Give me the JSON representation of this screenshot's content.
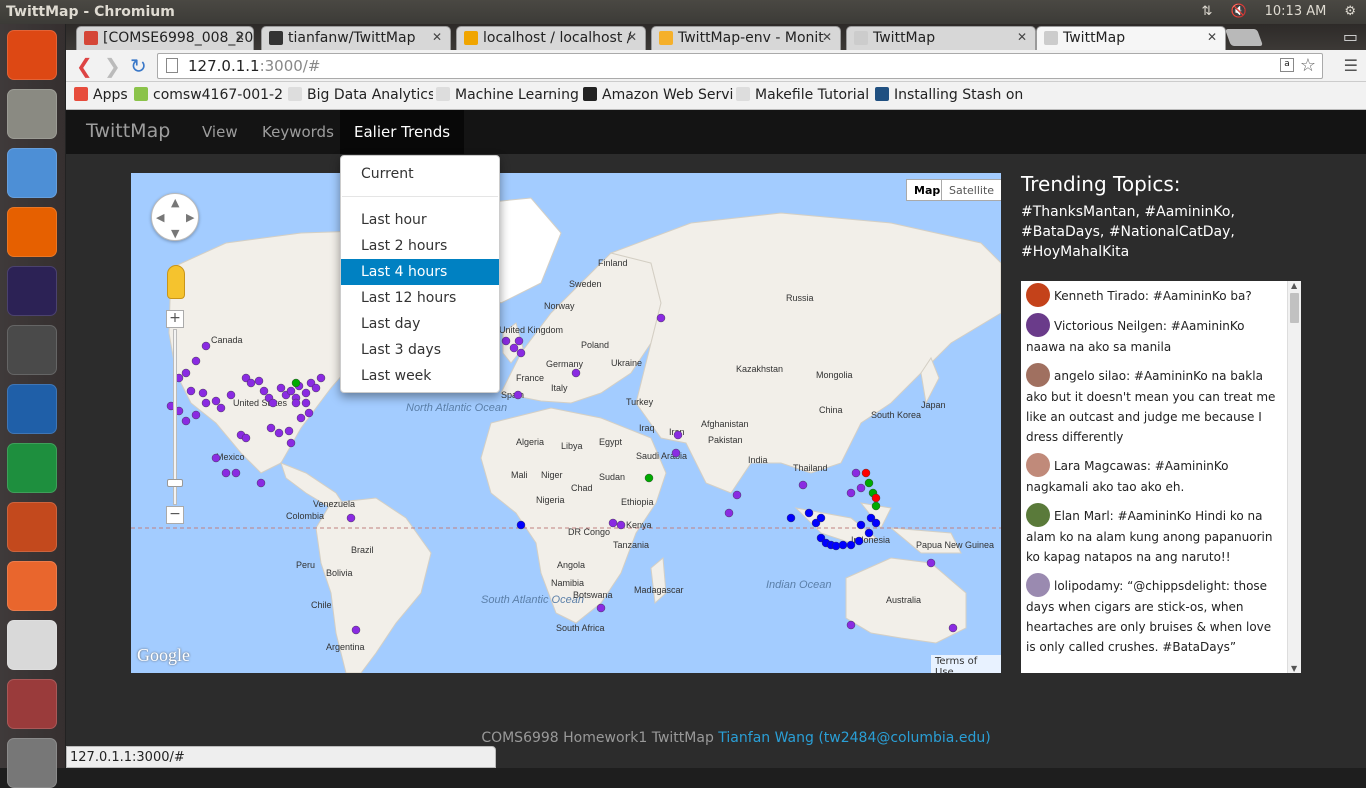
{
  "os": {
    "window_title": "TwittMap - Chromium",
    "clock": "10:13 AM",
    "launcher": [
      {
        "name": "ubuntu-dash-icon",
        "color": "#dd4814"
      },
      {
        "name": "files-icon",
        "color": "#8a8a82"
      },
      {
        "name": "chromium-icon",
        "color": "#4d8fd6"
      },
      {
        "name": "firefox-icon",
        "color": "#e66000"
      },
      {
        "name": "eclipse-icon",
        "color": "#2c2255"
      },
      {
        "name": "sublime-icon",
        "color": "#4a4a4a"
      },
      {
        "name": "writer-icon",
        "color": "#1f5fa8"
      },
      {
        "name": "calc-icon",
        "color": "#1e8f3e"
      },
      {
        "name": "impress-icon",
        "color": "#c3491d"
      },
      {
        "name": "software-center-icon",
        "color": "#e9662d"
      },
      {
        "name": "amazon-icon",
        "color": "#d9d9d9"
      },
      {
        "name": "system-settings-icon",
        "color": "#9a3b3b"
      },
      {
        "name": "trash-icon",
        "color": "#777777"
      }
    ]
  },
  "browser": {
    "tabs": [
      {
        "label": "[COMSE6998_008_20",
        "favicon_color": "#d54637"
      },
      {
        "label": "tianfanw/TwittMap",
        "favicon_color": "#333333"
      },
      {
        "label": "localhost / localhost /",
        "favicon_color": "#f0a500"
      },
      {
        "label": "TwittMap-env - Monit",
        "favicon_color": "#f5b02b"
      },
      {
        "label": "TwittMap",
        "favicon_color": "#cccccc"
      },
      {
        "label": "TwittMap",
        "favicon_color": "#cccccc"
      }
    ],
    "url_host": "127.0.1.1",
    "url_rest": ":3000/#",
    "bookmarks": [
      {
        "label": "Apps",
        "color": "#e74c3c"
      },
      {
        "label": "comsw4167-001-2",
        "color": "#8bc34a"
      },
      {
        "label": "Big Data Analytics",
        "color": "#dddddd"
      },
      {
        "label": "Machine Learning",
        "color": "#dddddd"
      },
      {
        "label": "Amazon Web Servi",
        "color": "#222222"
      },
      {
        "label": "Makefile Tutorial",
        "color": "#dddddd"
      },
      {
        "label": "Installing Stash on",
        "color": "#205081"
      }
    ],
    "status_url": "127.0.1.1:3000/#"
  },
  "app": {
    "brand": "TwittMap",
    "nav": {
      "view": "View",
      "keywords": "Keywords",
      "trends": "Ealier Trends"
    },
    "dropdown": {
      "current": "Current",
      "items": [
        "Last hour",
        "Last 2 hours",
        "Last 4 hours",
        "Last 12 hours",
        "Last day",
        "Last 3 days",
        "Last week"
      ],
      "selected": "Last 4 hours"
    },
    "map": {
      "map_button": "Map",
      "satellite_button": "Satellite",
      "google": "Google",
      "terms": "Terms of Use",
      "zoom_in": "+",
      "zoom_out": "−",
      "labels": [
        "Canada",
        "United States",
        "Mexico",
        "Venezuela",
        "Colombia",
        "Brazil",
        "Peru",
        "Bolivia",
        "Chile",
        "Argentina",
        "North Atlantic Ocean",
        "South Atlantic Ocean",
        "Indian Ocean",
        "Finland",
        "Sweden",
        "Norway",
        "United Kingdom",
        "Poland",
        "Germany",
        "Ukraine",
        "France",
        "Spain",
        "Italy",
        "Turkey",
        "Russia",
        "Kazakhstan",
        "Mongolia",
        "China",
        "South Korea",
        "Japan",
        "Afghanistan",
        "Pakistan",
        "Iran",
        "Iraq",
        "India",
        "Saudi Arabia",
        "Egypt",
        "Libya",
        "Algeria",
        "Mali",
        "Niger",
        "Chad",
        "Sudan",
        "Ethiopia",
        "Nigeria",
        "Kenya",
        "DR Congo",
        "Tanzania",
        "Angola",
        "Namibia",
        "Botswana",
        "Madagascar",
        "South Africa",
        "Thailand",
        "Indonesia",
        "Papua New Guinea",
        "Australia"
      ],
      "dot_colors": {
        "purple": "#8a2be2",
        "blue": "#0000ff",
        "green": "#00aa00",
        "red": "#ff0000"
      }
    },
    "trending": {
      "title": "Trending Topics:",
      "topics": "#ThanksMantan, #AamininKo, #BataDays, #NationalCatDay, #HoyMahalKita"
    },
    "tweets": [
      {
        "user": "Kenneth Tirado",
        "text": "#AamininKo ba?",
        "avatar": "#c4421a"
      },
      {
        "user": "Victorious Neilgen",
        "text": "#AamininKo naawa na ako sa manila",
        "avatar": "#6a3b8a"
      },
      {
        "user": "angelo silao",
        "text": "#AamininKo na bakla ako but it doesn't mean you can treat me like an outcast and judge me because I dress differently",
        "avatar": "#a07060"
      },
      {
        "user": "Lara Magcawas",
        "text": "#AamininKo nagkamali ako tao ako eh.",
        "avatar": "#c08a7a"
      },
      {
        "user": "Elan Marl",
        "text": "#AamininKo Hindi ko na alam ko na alam kung anong papanuorin ko kapag natapos na ang naruto!!",
        "avatar": "#5a7a3a"
      },
      {
        "user": "lolipodamy",
        "text": "“@chippsdelight: those days when cigars are stick-os, when heartaches are only bruises & when love is only called crushes. #BataDays”",
        "avatar": "#9a8ab0"
      }
    ],
    "footer": {
      "text": "COMS6998 Homework1 TwittMap",
      "link": "Tianfan Wang (tw2484@columbia.edu)"
    }
  }
}
